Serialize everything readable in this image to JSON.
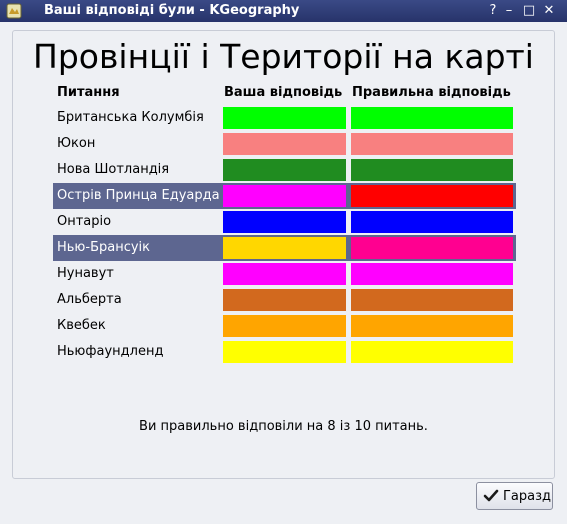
{
  "window": {
    "title": "Ваші відповіді були - KGeography",
    "buttons": {
      "help": "?",
      "minimize": "–",
      "maximize": "□",
      "close": "✕"
    }
  },
  "heading": "Провінції і Території на карті",
  "columns": {
    "question": "Питання",
    "your_answer": "Ваша відповідь",
    "correct_answer": "Правильна відповідь"
  },
  "rows": [
    {
      "label": "Британська Колумбія",
      "your_color": "#00ff00",
      "correct_color": "#00ff00",
      "correct": true
    },
    {
      "label": "Юкон",
      "your_color": "#f88080",
      "correct_color": "#f88080",
      "correct": true
    },
    {
      "label": "Нова Шотландія",
      "your_color": "#208c20",
      "correct_color": "#208c20",
      "correct": true
    },
    {
      "label": "Острів Принца Едуарда",
      "your_color": "#ff00ff",
      "correct_color": "#ff0000",
      "correct": false
    },
    {
      "label": "Онтаріо",
      "your_color": "#0000ff",
      "correct_color": "#0000ff",
      "correct": true
    },
    {
      "label": "Нью-Брансуік",
      "your_color": "#ffd700",
      "correct_color": "#ff0090",
      "correct": false
    },
    {
      "label": "Нунавут",
      "your_color": "#ff00ff",
      "correct_color": "#ff00ff",
      "correct": true
    },
    {
      "label": "Альберта",
      "your_color": "#d2691e",
      "correct_color": "#d2691e",
      "correct": true
    },
    {
      "label": "Квебек",
      "your_color": "#ffa500",
      "correct_color": "#ffa500",
      "correct": true
    },
    {
      "label": "Ньюфаундленд",
      "your_color": "#ffff00",
      "correct_color": "#ffff00",
      "correct": true
    }
  ],
  "summary": "Ви правильно відповіли на 8 із 10 питань.",
  "ok_button": {
    "label": "Гаразд",
    "icon": "check-icon"
  },
  "colors": {
    "titlebar": "#2f3c78",
    "wrong_row_highlight": "#5d6690"
  }
}
